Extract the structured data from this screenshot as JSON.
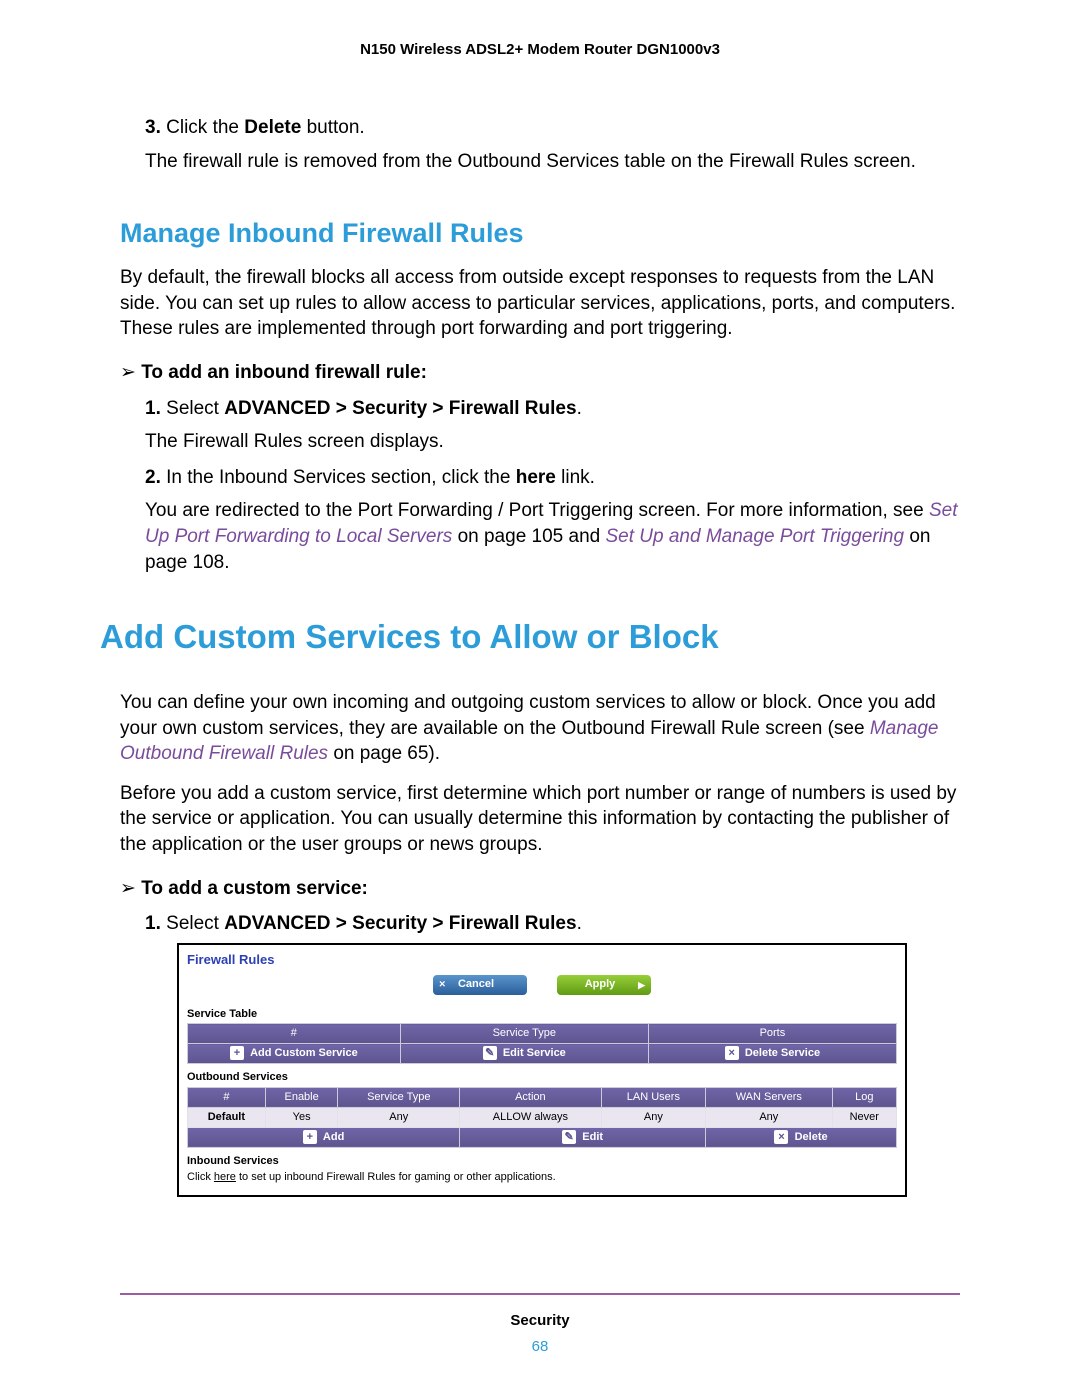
{
  "header": {
    "product": "N150 Wireless ADSL2+ Modem Router DGN1000v3"
  },
  "top_step": {
    "num": "3.",
    "text_before": "Click the ",
    "bold": "Delete",
    "text_after": " button.",
    "result": "The firewall rule is removed from the Outbound Services table on the Firewall Rules screen."
  },
  "h2_inbound": "Manage Inbound Firewall Rules",
  "inbound_intro": "By default, the firewall blocks all access from outside except responses to requests from the LAN side. You can set up rules to allow access to particular services, applications, ports, and computers. These rules are implemented through port forwarding and port triggering.",
  "inbound_proc_head": "To add an inbound firewall rule:",
  "inbound_steps": [
    {
      "num": "1.",
      "text_before": "Select ",
      "bold": "ADVANCED > Security > Firewall Rules",
      "text_after": ".",
      "result": "The Firewall Rules screen displays."
    },
    {
      "num": "2.",
      "text_before": "In the Inbound Services section, click the ",
      "bold": "here",
      "text_after": " link.",
      "result_a": "You are redirected to the Port Forwarding / Port Triggering screen. For more information, see ",
      "link1": "Set Up Port Forwarding to Local Servers",
      "mid1": " on page 105 and ",
      "link2": "Set Up and Manage Port Triggering",
      "mid2": " on page 108."
    }
  ],
  "h1_custom": "Add Custom Services to Allow or Block",
  "custom_para1_a": "You can define your own incoming and outgoing custom services to allow or block. Once you add your own custom services, they are available on the Outbound Firewall Rule screen (see ",
  "custom_para1_link": "Manage Outbound Firewall Rules",
  "custom_para1_b": " on page 65).",
  "custom_para2": "Before you add a custom service, first determine which port number or range of numbers is used by the service or application. You can usually determine this information by contacting the publisher of the application or the user groups or news groups.",
  "custom_proc_head": "To add a custom service:",
  "custom_step1": {
    "num": "1.",
    "text_before": "Select ",
    "bold": "ADVANCED > Security > Firewall Rules",
    "text_after": "."
  },
  "fig": {
    "title": "Firewall Rules",
    "cancel": "Cancel",
    "apply": "Apply",
    "service_table": {
      "title": "Service Table",
      "headers": [
        "#",
        "Service Type",
        "Ports"
      ],
      "actions": {
        "add": "Add Custom Service",
        "edit": "Edit Service",
        "del": "Delete Service"
      }
    },
    "outbound": {
      "title": "Outbound Services",
      "headers": [
        "#",
        "Enable",
        "Service Type",
        "Action",
        "LAN Users",
        "WAN Servers",
        "Log"
      ],
      "row": [
        "Default",
        "Yes",
        "Any",
        "ALLOW always",
        "Any",
        "Any",
        "Never"
      ],
      "actions": {
        "add": "Add",
        "edit": "Edit",
        "del": "Delete"
      }
    },
    "inbound": {
      "title": "Inbound Services",
      "note_a": "Click ",
      "note_link": "here",
      "note_b": " to set up inbound Firewall Rules for gaming or other applications."
    }
  },
  "footer": {
    "section": "Security",
    "page": "68"
  }
}
